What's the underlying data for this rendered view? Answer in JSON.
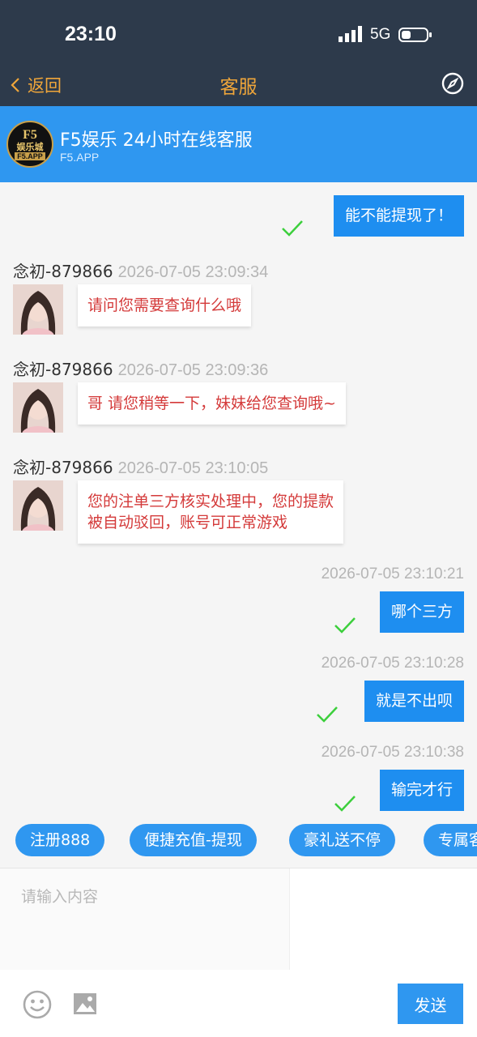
{
  "status_bar": {
    "time": "23:10",
    "network": "5G"
  },
  "nav": {
    "back_label": "返回",
    "title": "客服"
  },
  "header": {
    "logo_text_top": "F5",
    "logo_text_mid": "娱乐城",
    "logo_text_bottom": "F5.APP",
    "name": "F5娱乐 24小时在线客服",
    "subtitle": "F5.APP"
  },
  "messages": [
    {
      "side": "out",
      "text": "能不能提现了！",
      "status": "sent"
    },
    {
      "side": "in",
      "sender": "念初-879866",
      "time": "2026-07-05 23:09:34",
      "text": "请问您需要查询什么哦"
    },
    {
      "side": "in",
      "sender": "念初-879866",
      "time": "2026-07-05 23:09:36",
      "text": "哥 请您稍等一下，妹妹给您查询哦~"
    },
    {
      "side": "in",
      "sender": "念初-879866",
      "time": "2026-07-05 23:10:05",
      "text_line1": "您的注单三方核实处理中，您的提款",
      "text_line2": "被自动驳回，账号可正常游戏"
    },
    {
      "side": "out",
      "time": "2026-07-05 23:10:21",
      "text": "哪个三方",
      "status": "sent"
    },
    {
      "side": "out",
      "time": "2026-07-05 23:10:28",
      "text": "就是不出呗",
      "status": "sent"
    },
    {
      "side": "out",
      "time": "2026-07-05 23:10:38",
      "text": "输完才行",
      "status": "sent"
    }
  ],
  "quick_replies": [
    "注册888",
    "便捷充值-提现",
    "豪礼送不停",
    "专属客服"
  ],
  "input": {
    "placeholder": "请输入内容",
    "value": ""
  },
  "send_label": "发送",
  "colors": {
    "nav_bg": "#2d3a4b",
    "accent_orange": "#f0a63a",
    "header_blue": "#2f97f0",
    "out_bubble": "#1e8ef0",
    "in_text_red": "#d43a3a",
    "check_green": "#3ccf3c"
  },
  "icons": {
    "back": "chevron-left-icon",
    "compass": "compass-icon",
    "check": "check-icon",
    "emoji": "emoji-icon",
    "image": "image-icon"
  }
}
